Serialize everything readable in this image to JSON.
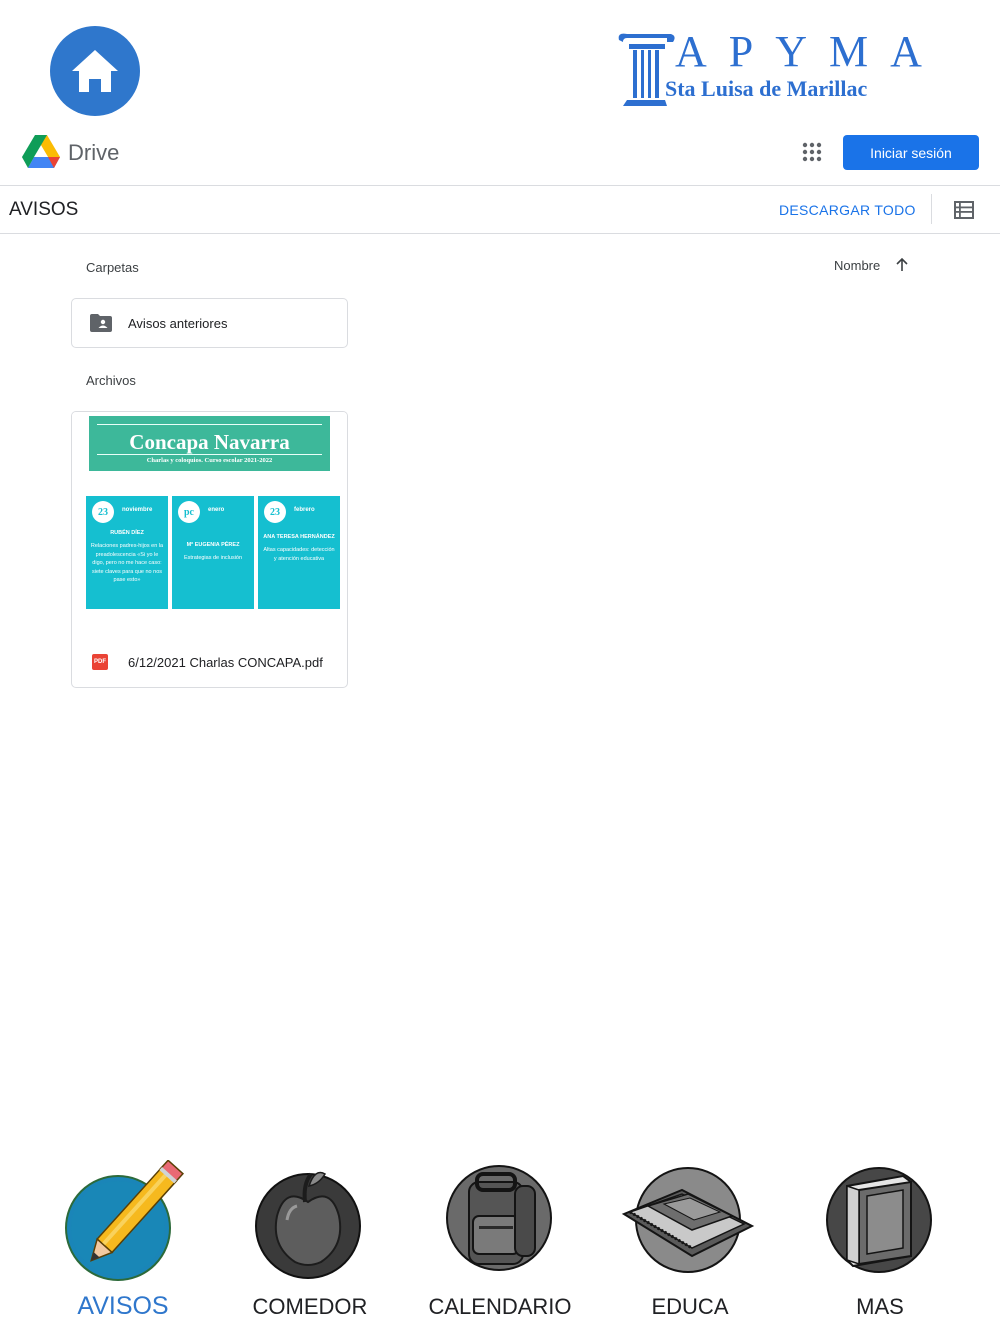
{
  "header": {
    "home_icon": "home-icon",
    "logo_title": "APYMA",
    "logo_subtitle": "Sta Luisa de Marillac"
  },
  "drive": {
    "product_name": "Drive",
    "apps_icon": "apps-grid-icon",
    "signin_label": "Iniciar sesión",
    "signin_color": "#1a73e8",
    "folder_title": "AVISOS",
    "download_all_label": "DESCARGAR TODO",
    "view_icon": "list-view-icon",
    "folders_label": "Carpetas",
    "sort_label": "Nombre",
    "sort_icon": "arrow-up-icon",
    "folders": [
      {
        "name": "Avisos anteriores",
        "icon": "shared-folder-icon"
      }
    ],
    "files_label": "Archivos",
    "files": [
      {
        "name": "6/12/2021 Charlas CONCAPA.pdf",
        "type_badge": "PDF",
        "thumbnail": {
          "title": "Concapa Navarra",
          "subtitle": "Charlas y coloquios. Curso escolar 2021-2022",
          "banner_color": "#3db89a",
          "box_color": "#15bfd0",
          "boxes": [
            {
              "day": "23",
              "month": "noviembre",
              "speaker": "RUBÉN DÍEZ",
              "topic": "Relaciones padres-hijos en la preadolescencia «Si yo le digo, pero no me hace caso: siete claves para que no nos pase esto»"
            },
            {
              "day": "pc",
              "month": "enero",
              "speaker": "Mª EUGENIA PÉREZ",
              "topic": "Estrategias de inclusión"
            },
            {
              "day": "23",
              "month": "febrero",
              "speaker": "ANA TERESA HERNÁNDEZ",
              "topic": "Altas capacidades: detección y atención educativa"
            }
          ]
        }
      }
    ]
  },
  "bottom_nav": {
    "active_color": "#2f77cc",
    "items": [
      {
        "label": "AVISOS",
        "icon": "pencil-icon",
        "active": true
      },
      {
        "label": "COMEDOR",
        "icon": "apple-icon",
        "active": false
      },
      {
        "label": "CALENDARIO",
        "icon": "backpack-icon",
        "active": false
      },
      {
        "label": "EDUCA",
        "icon": "notebooks-icon",
        "active": false
      },
      {
        "label": "MAS",
        "icon": "book-icon",
        "active": false
      }
    ]
  }
}
